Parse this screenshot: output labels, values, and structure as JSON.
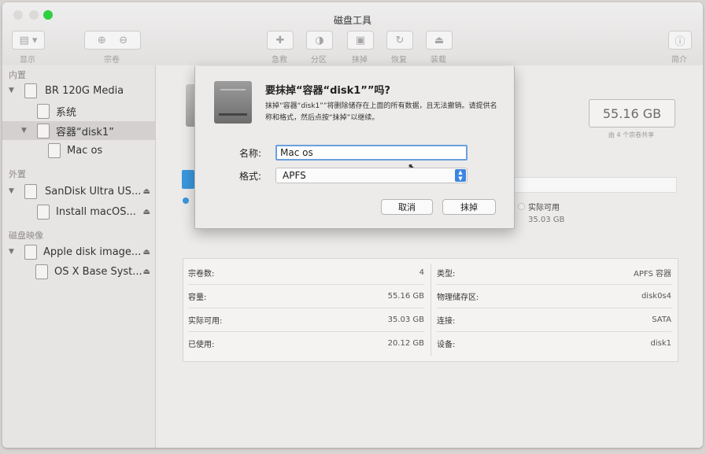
{
  "window": {
    "title": "磁盘工具"
  },
  "toolbar": {
    "view_label": "显示",
    "volume_label": "宗卷",
    "first_aid_label": "急救",
    "partition_label": "分区",
    "erase_label": "抹掉",
    "restore_label": "恢复",
    "mount_label": "装载",
    "info_label": "简介"
  },
  "sidebar": {
    "internal_header": "内置",
    "external_header": "外置",
    "images_header": "磁盘映像",
    "items": [
      {
        "label": "BR 120G Media"
      },
      {
        "label": "系统"
      },
      {
        "label": "容器“disk1”"
      },
      {
        "label": "Mac os"
      },
      {
        "label": "SanDisk Ultra US..."
      },
      {
        "label": "Install macOS..."
      },
      {
        "label": "Apple disk image..."
      },
      {
        "label": "OS X Base Syst..."
      }
    ]
  },
  "main": {
    "capacity": "55.16 GB",
    "capacity_sub": "由 4 个宗卷共享",
    "available_label": "实际可用",
    "available_value": "35.03 GB",
    "info_left": [
      {
        "key": "宗卷数:",
        "value": "4"
      },
      {
        "key": "容量:",
        "value": "55.16 GB"
      },
      {
        "key": "实际可用:",
        "value": "35.03 GB"
      },
      {
        "key": "已使用:",
        "value": "20.12 GB"
      }
    ],
    "info_right": [
      {
        "key": "类型:",
        "value": "APFS 容器"
      },
      {
        "key": "物理储存区:",
        "value": "disk0s4"
      },
      {
        "key": "连接:",
        "value": "SATA"
      },
      {
        "key": "设备:",
        "value": "disk1"
      }
    ]
  },
  "dialog": {
    "title": "要抹掉“容器“disk1””吗?",
    "description": "抹掉“容器“disk1””将删除储存在上面的所有数据，且无法撤销。请提供名称和格式，然后点按“抹掉”以继续。",
    "name_label": "名称:",
    "name_value": "Mac os",
    "format_label": "格式:",
    "format_value": "APFS",
    "cancel_label": "取消",
    "erase_label": "抹掉"
  }
}
